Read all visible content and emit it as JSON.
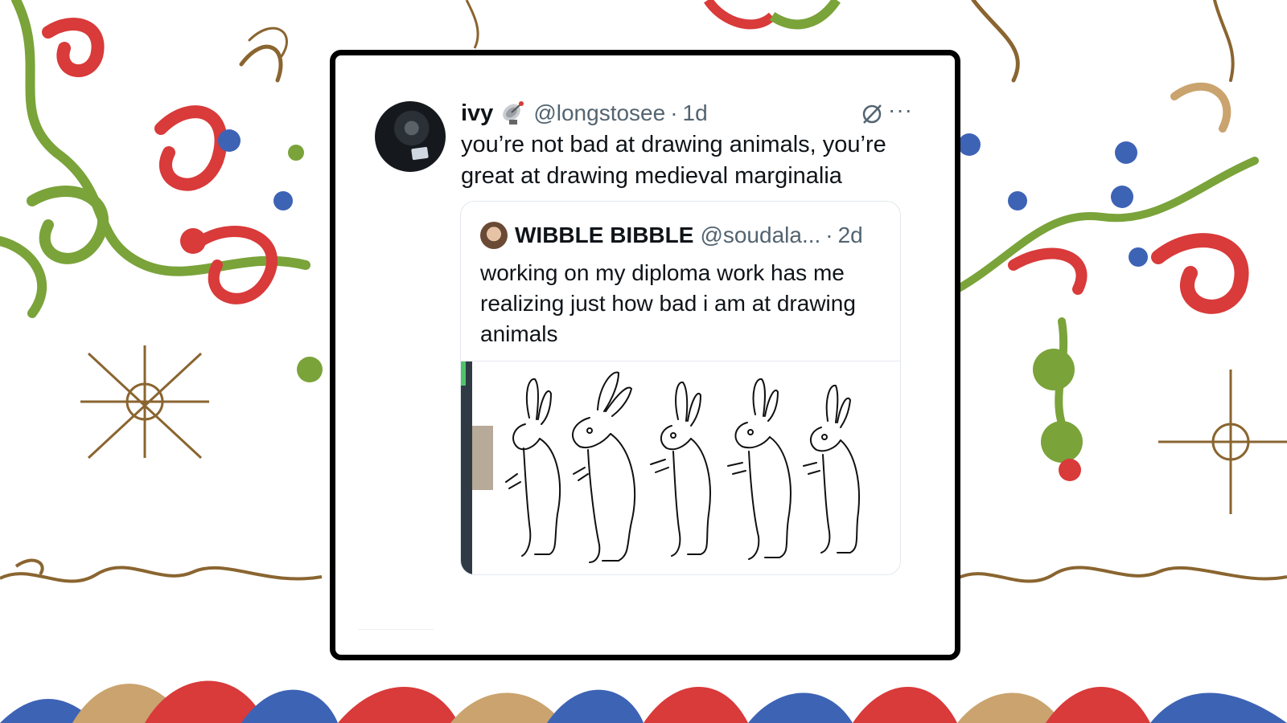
{
  "tweet": {
    "display_name": "ivy",
    "emoji_icon": "satellite-antenna-icon",
    "handle": "@longstosee",
    "separator": "·",
    "time": "1d",
    "text": "you’re not bad at drawing animals, you’re great at drawing medieval marginalia",
    "more_label": "···",
    "grok_icon": "grok-icon"
  },
  "quoted": {
    "display_name": "WIBBLE BIBBLE",
    "handle": "@soudala...",
    "separator": "·",
    "time": "2d",
    "text": "working on my diploma work has me realizing just how bad i am at drawing animals",
    "media_icon": "rabbit-sketches-image"
  },
  "colors": {
    "ornament_red": "#d93a3a",
    "ornament_green": "#7aa33a",
    "ornament_blue": "#3d63b5",
    "ornament_gold": "#8a6530",
    "ornament_tan": "#caa36e",
    "text_primary": "#0f1419",
    "text_secondary": "#536471"
  }
}
